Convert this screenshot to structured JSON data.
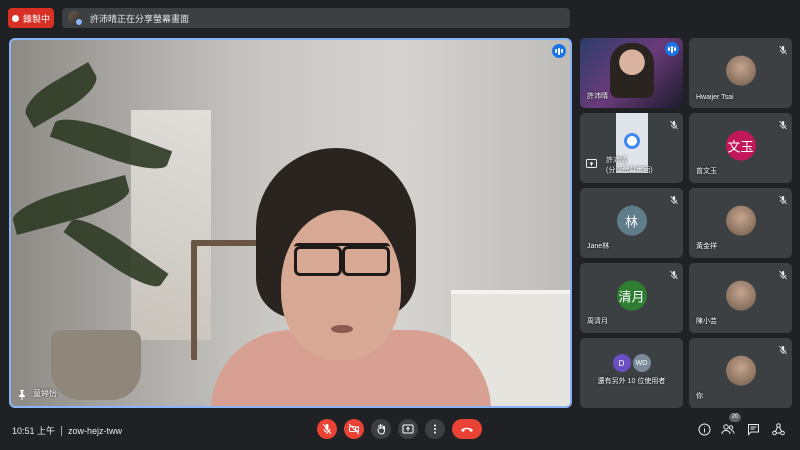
{
  "top": {
    "recording_label": "錄製中",
    "share_banner_text": "許沛晴正在分享螢幕畫面"
  },
  "main": {
    "speaker_name": "童婷怡"
  },
  "tiles": [
    {
      "name": "許沛晴",
      "kind": "video",
      "speaking": true
    },
    {
      "name": "Hwaijer Tsai",
      "kind": "photo",
      "muted": true
    },
    {
      "name": "許沛晴\n(分享螢幕畫面)",
      "kind": "screenshare",
      "muted": true
    },
    {
      "name": "曾文玉",
      "kind": "initial",
      "initial": "文玉",
      "color": "#c2185b",
      "muted": true
    },
    {
      "name": "Jane林",
      "kind": "initial",
      "initial": "林",
      "color": "#607d8b",
      "muted": true
    },
    {
      "name": "黃金祥",
      "kind": "photo",
      "muted": true
    },
    {
      "name": "周清月",
      "kind": "initial",
      "initial": "清月",
      "color": "#2e7d32",
      "muted": true
    },
    {
      "name": "陳小芸",
      "kind": "photo",
      "muted": true
    },
    {
      "name": "還有另外 10 位使用者",
      "kind": "others",
      "initials": [
        "D",
        "WD"
      ],
      "muted": false
    },
    {
      "name": "你",
      "kind": "photo",
      "muted": true
    }
  ],
  "bottom": {
    "time": "10:51 上午",
    "meeting_code": "zow-hejz-tww",
    "people_count": "20"
  },
  "colors": {
    "accent": "#8ab4f8",
    "danger": "#ea4335",
    "surface": "#3c4043",
    "background": "#202124"
  },
  "icons": [
    "mic-off-icon",
    "camera-off-icon",
    "raise-hand-icon",
    "present-icon",
    "more-options-icon",
    "end-call-icon",
    "info-icon",
    "people-icon",
    "chat-icon",
    "activities-icon"
  ]
}
